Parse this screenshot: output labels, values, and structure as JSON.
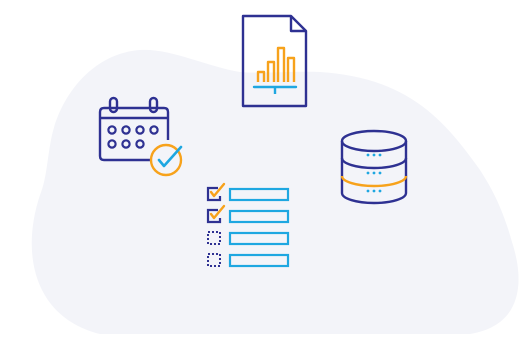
{
  "palette": {
    "background": "#ffffff",
    "blob": "#f3f4f9",
    "navy": "#2e3192",
    "orange": "#f7a21b",
    "cyan": "#1ea7e1"
  },
  "icons": [
    "document-bar-chart-icon",
    "calendar-check-icon",
    "database-icon",
    "checklist-icon"
  ],
  "checklist": {
    "items": [
      {
        "checked": true
      },
      {
        "checked": true
      },
      {
        "checked": false
      },
      {
        "checked": false
      }
    ]
  }
}
